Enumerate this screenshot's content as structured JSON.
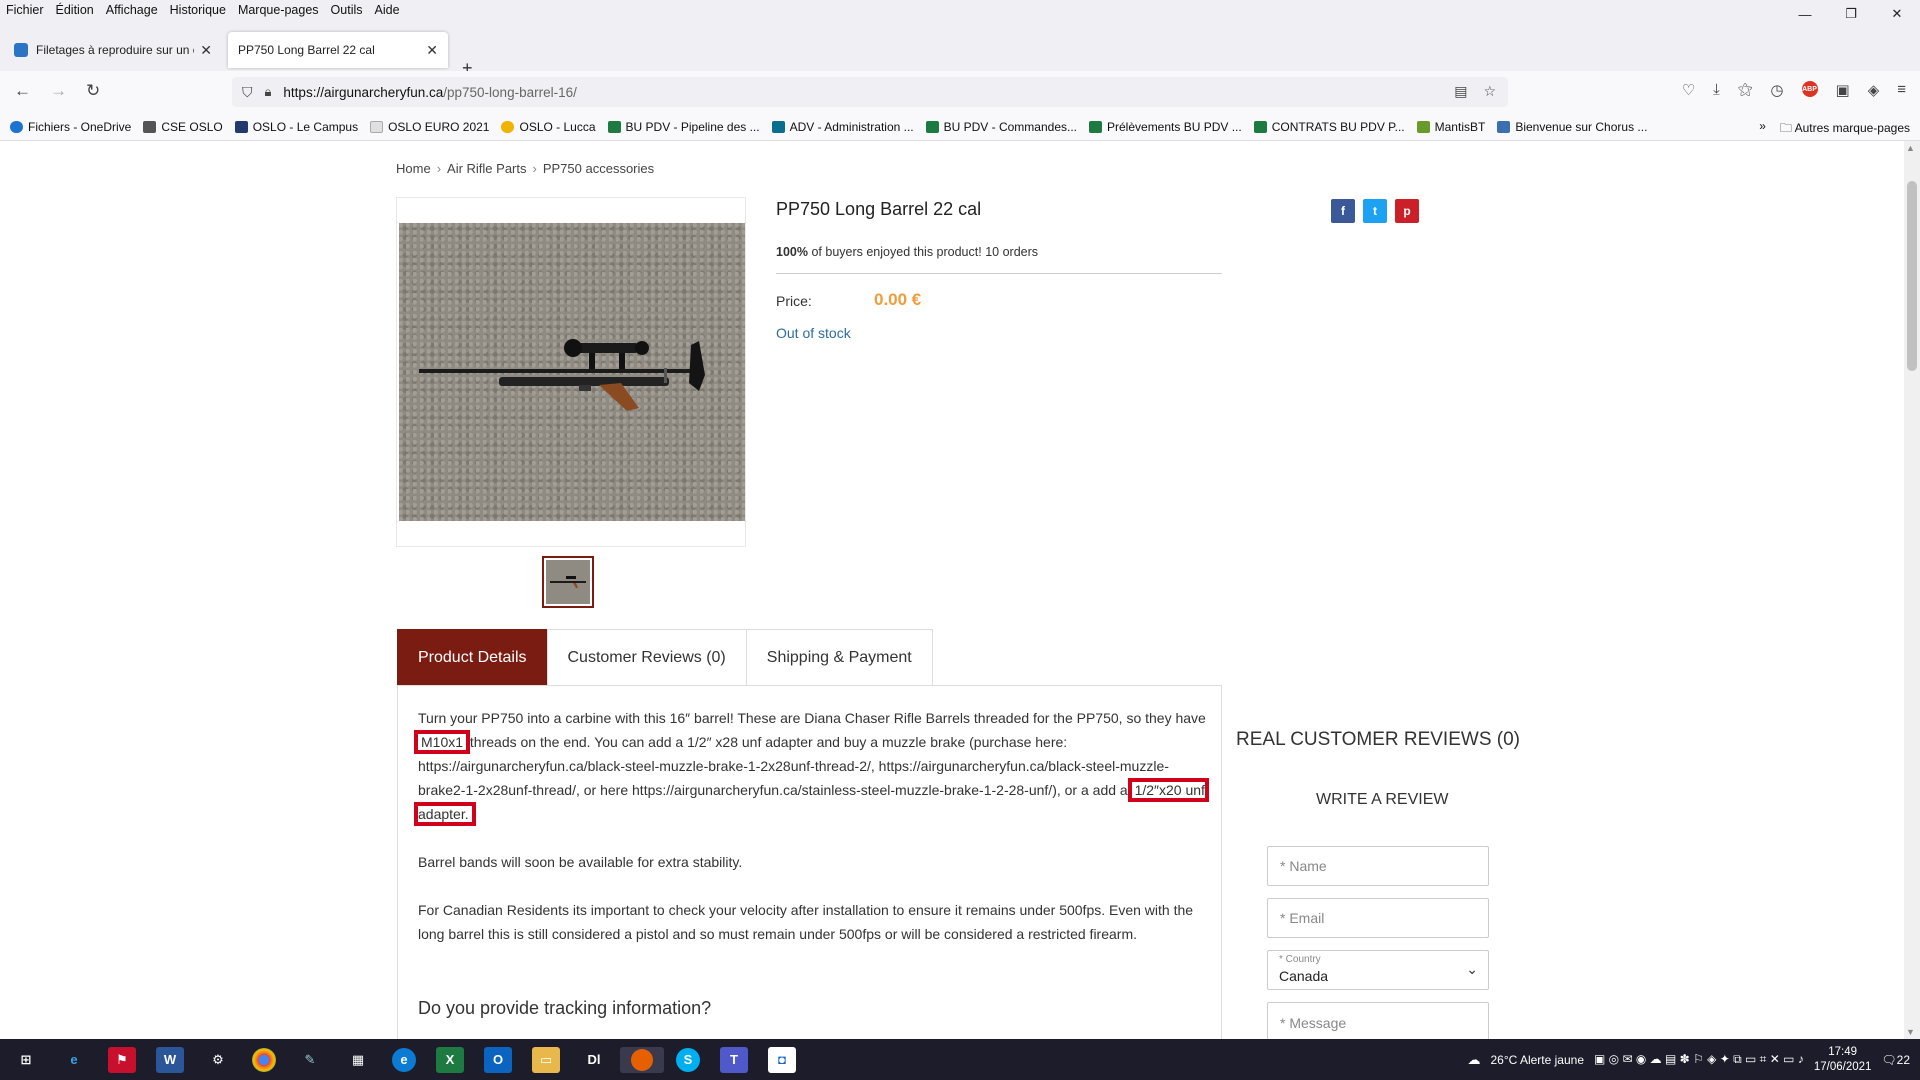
{
  "menubar": {
    "items": [
      "Fichier",
      "Édition",
      "Affichage",
      "Historique",
      "Marque-pages",
      "Outils",
      "Aide"
    ]
  },
  "window_controls": {
    "minimize": "—",
    "restore": "❐",
    "close": "✕"
  },
  "tabs": [
    {
      "title": "Filetages à reproduire sur un ca",
      "active": false
    },
    {
      "title": "PP750 Long Barrel 22 cal",
      "active": true
    }
  ],
  "newtab": "+",
  "address": {
    "host": "https://airgunarcheryfun.ca",
    "path": "/pp750-long-barrel-16/"
  },
  "bookmarks": [
    {
      "label": "Fichiers - OneDrive",
      "color": "#1e73d2"
    },
    {
      "label": "CSE OSLO",
      "color": "#555"
    },
    {
      "label": "OSLO - Le Campus",
      "color": "#233a6e"
    },
    {
      "label": "OSLO EURO 2021",
      "color": "#e0e0e0"
    },
    {
      "label": "OSLO - Lucca",
      "color": "#f0b400"
    },
    {
      "label": "BU PDV - Pipeline des ...",
      "color": "#1d7a40"
    },
    {
      "label": "ADV - Administration ...",
      "color": "#0a6f8c"
    },
    {
      "label": "BU PDV - Commandes...",
      "color": "#1d7a40"
    },
    {
      "label": "Prélèvements BU PDV ...",
      "color": "#1d7a40"
    },
    {
      "label": "CONTRATS BU PDV P...",
      "color": "#1d7a40"
    },
    {
      "label": "MantisBT",
      "color": "#6a9a2a"
    },
    {
      "label": "Bienvenue sur Chorus ...",
      "color": "#3b6fb0"
    }
  ],
  "other_bookmarks": "Autres marque-pages",
  "breadcrumb": [
    "Home",
    "Air Rifle Parts",
    "PP750 accessories"
  ],
  "product": {
    "title": "PP750 Long Barrel 22 cal",
    "buyers_pct": "100%",
    "buyers_text": "of buyers enjoyed this product!",
    "orders": "10 orders",
    "price_label": "Price:",
    "price": "0.00 €",
    "stock": "Out of stock"
  },
  "share": {
    "facebook": "f",
    "twitter": "t",
    "pinterest": "p"
  },
  "product_tabs": [
    "Product Details",
    "Customer Reviews (0)",
    "Shipping & Payment"
  ],
  "description": {
    "p1_a": "Turn your PP750 into a carbine with this 16″ barrel! These are Diana Chaser Rifle Barrels threaded for the PP750, so they have",
    "p1_hl1": "M10x1",
    "p1_b": "threads on the end. You can add a 1/2″ x28 unf adapter and buy a muzzle brake (purchase here: https://airgunarcheryfun.ca/black-steel-muzzle-brake-1-2x28unf-thread-2/, https://airgunarcheryfun.ca/black-steel-muzzle-brake2-1-2x28unf-thread/, or here https://airgunarcheryfun.ca/stainless-steel-muzzle-brake-1-2-28-unf/), or a add a",
    "p1_hl2": "1/2″x20 unf adapter.",
    "p2": "Barrel bands will soon be available for extra stability.",
    "p3": "For Canadian Residents its important to check your velocity after installation to ensure it remains under 500fps. Even with the long barrel this is still considered a pistol and so must remain under 500fps or will be considered a restricted firearm.",
    "faq_question": "Do you provide tracking information?"
  },
  "reviews": {
    "title": "REAL CUSTOMER REVIEWS (0)",
    "write_title": "WRITE A REVIEW",
    "name_placeholder": "* Name",
    "email_placeholder": "* Email",
    "country_label": "* Country",
    "country_value": "Canada",
    "message_placeholder": "* Message"
  },
  "taskbar": {
    "weather": "26°C  Alerte jaune",
    "time": "17:49",
    "date": "17/06/2021",
    "notifications": "22"
  }
}
